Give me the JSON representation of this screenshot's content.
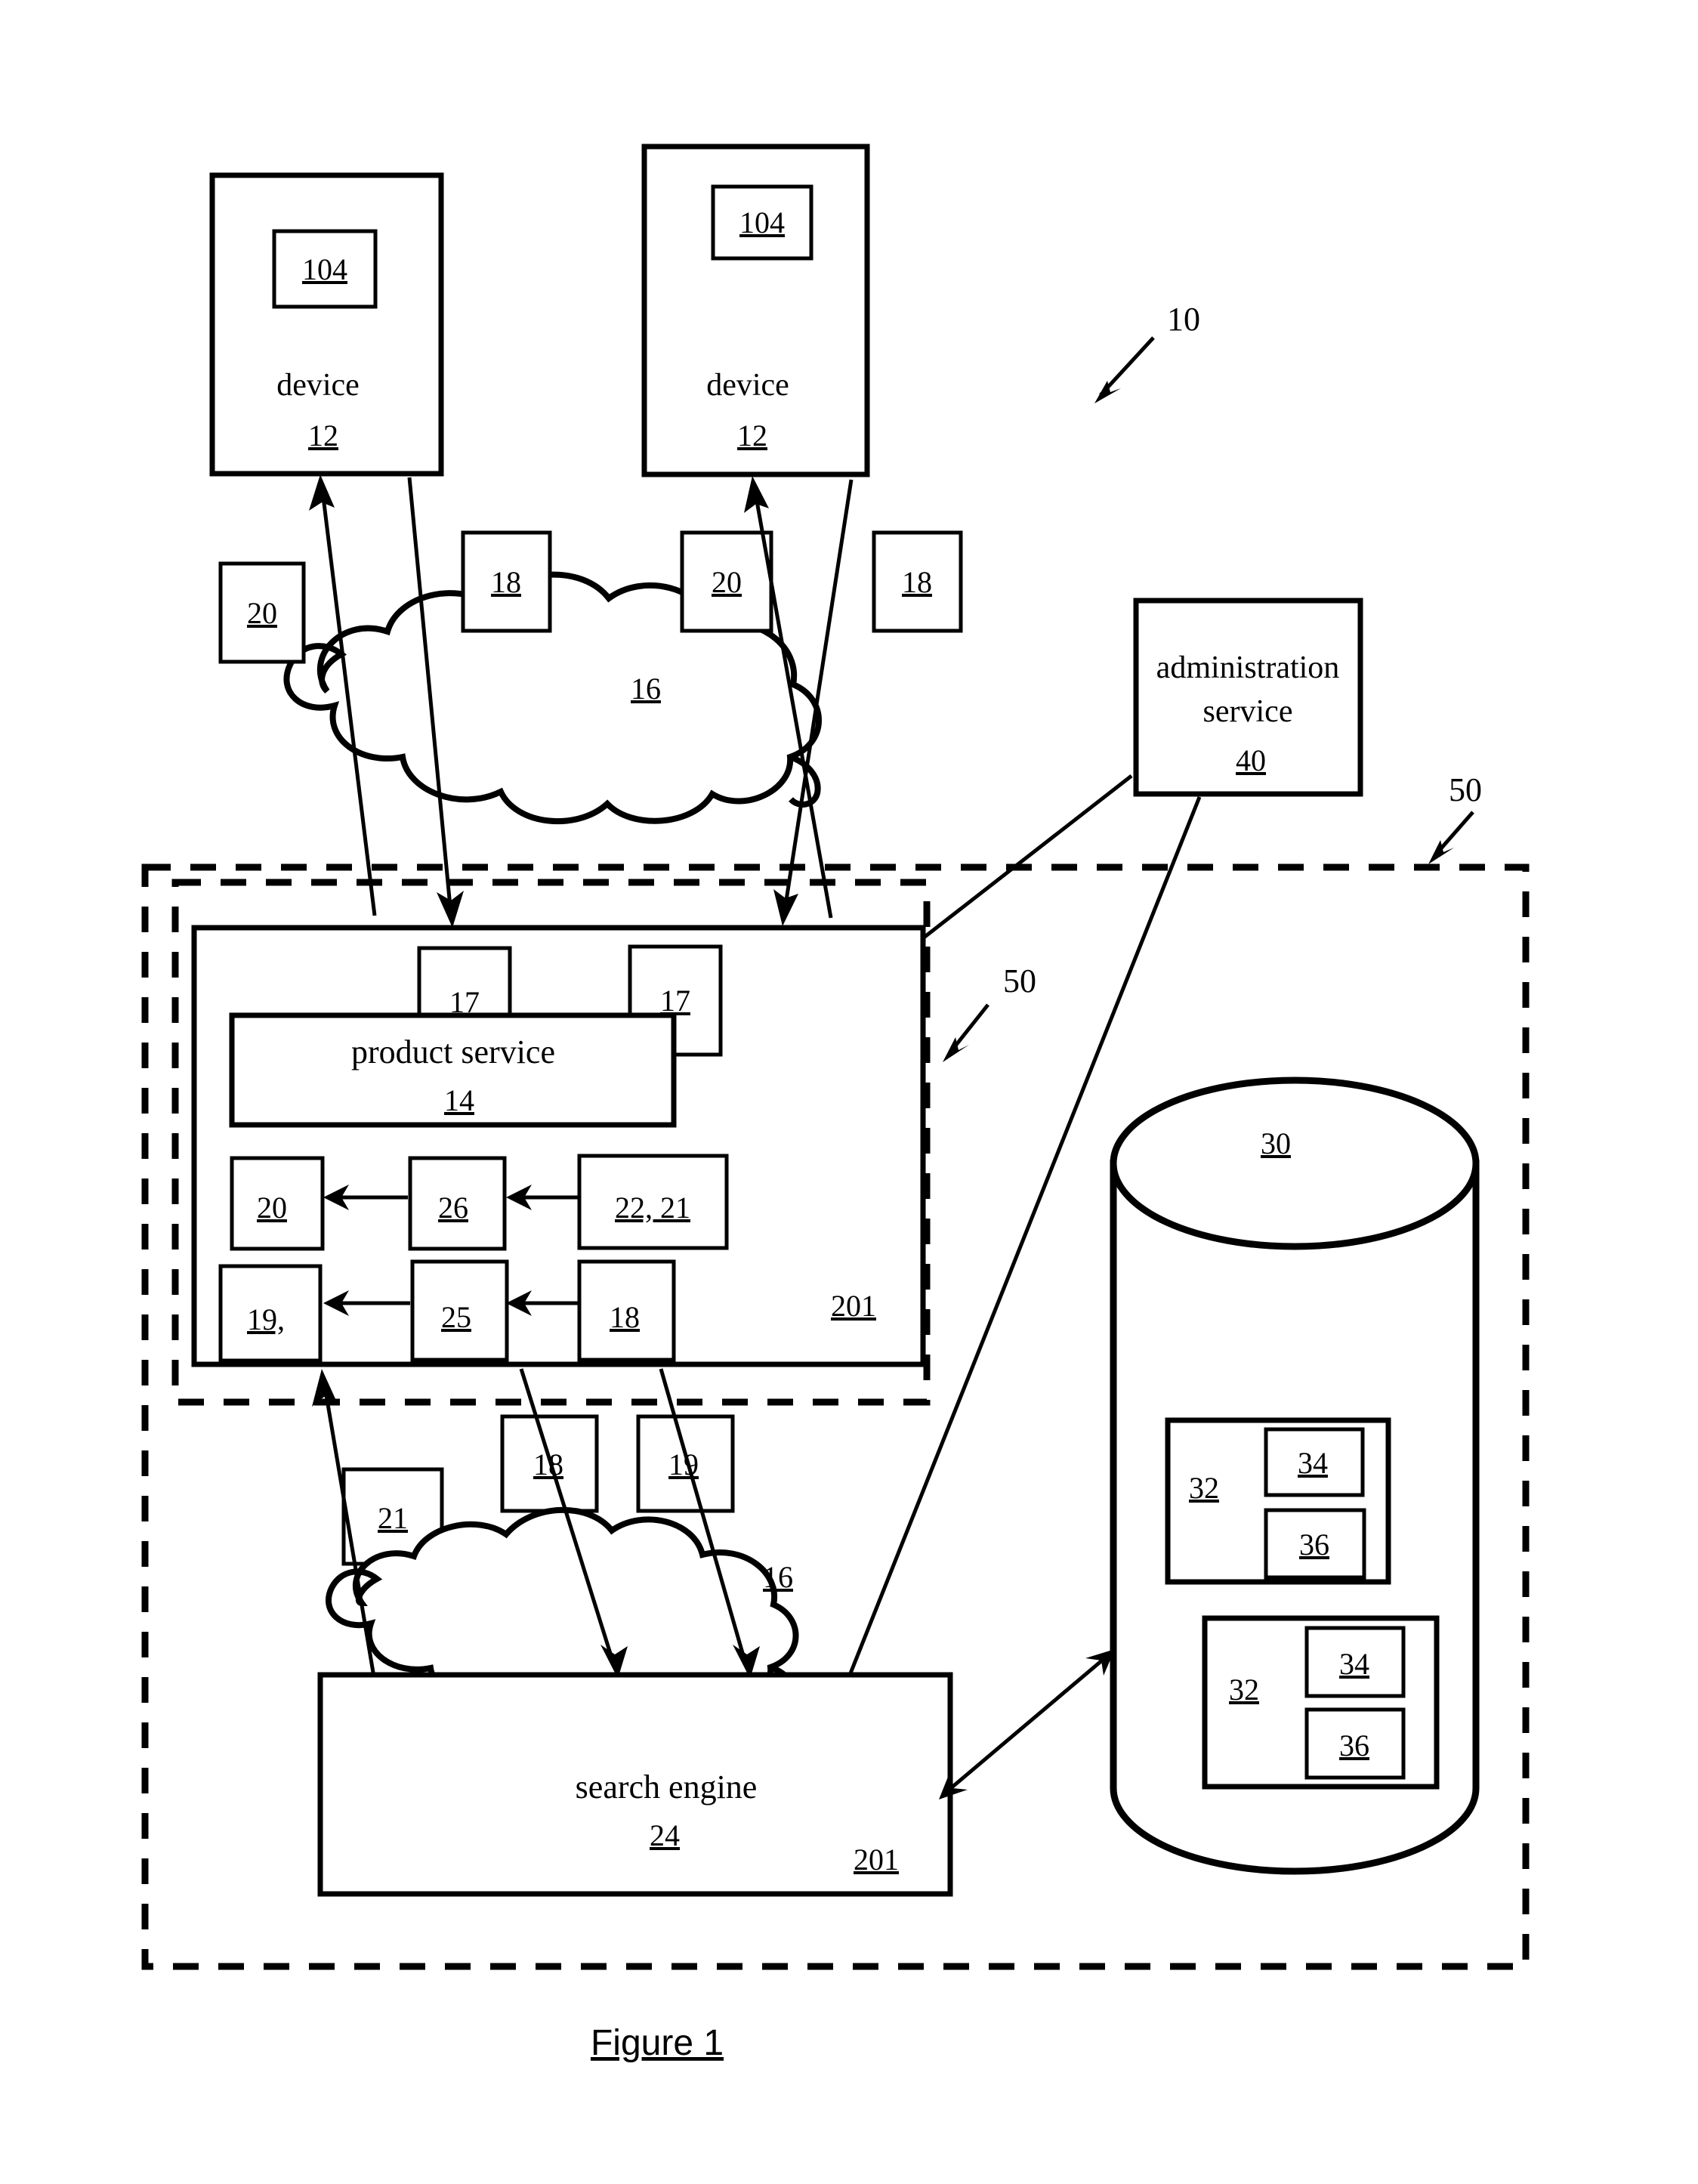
{
  "figure": {
    "caption": "Figure 1",
    "system_ref": "10"
  },
  "devices": [
    {
      "name": "device",
      "ref": "12",
      "inner_ref": "104"
    },
    {
      "name": "device",
      "ref": "12",
      "inner_ref": "104"
    }
  ],
  "networks": [
    {
      "ref": "16",
      "position": "upper"
    },
    {
      "ref": "16",
      "position": "lower"
    }
  ],
  "upper_link_labels": [
    {
      "ref": "20"
    },
    {
      "ref": "18"
    },
    {
      "ref": "20"
    },
    {
      "ref": "18"
    }
  ],
  "administration": {
    "line1": "administration",
    "line2": "service",
    "ref": "40"
  },
  "boundary_labels": [
    {
      "ref": "50",
      "position": "outer"
    },
    {
      "ref": "50",
      "position": "inner"
    }
  ],
  "product_service_panel": {
    "ref": "201",
    "interface_refs": [
      {
        "ref": "17"
      },
      {
        "ref": "17"
      }
    ],
    "service": {
      "name": "product service",
      "ref": "14"
    },
    "flow_row_top": [
      {
        "ref": "20"
      },
      {
        "ref": "26"
      },
      {
        "ref": "22, 21"
      }
    ],
    "flow_row_bottom": [
      {
        "ref": "19,"
      },
      {
        "ref": "25"
      },
      {
        "ref": "18"
      }
    ]
  },
  "lower_link_labels": [
    {
      "ref": "21"
    },
    {
      "ref": "18"
    },
    {
      "ref": "19"
    }
  ],
  "search_engine_panel": {
    "name": "search engine",
    "ref": "24",
    "panel_ref": "201"
  },
  "database": {
    "ref": "30",
    "records": [
      {
        "ref": "32",
        "field_a": "34",
        "field_b": "36"
      },
      {
        "ref": "32",
        "field_a": "34",
        "field_b": "36"
      }
    ]
  },
  "colors": {
    "stroke": "#000000",
    "background": "#ffffff"
  }
}
